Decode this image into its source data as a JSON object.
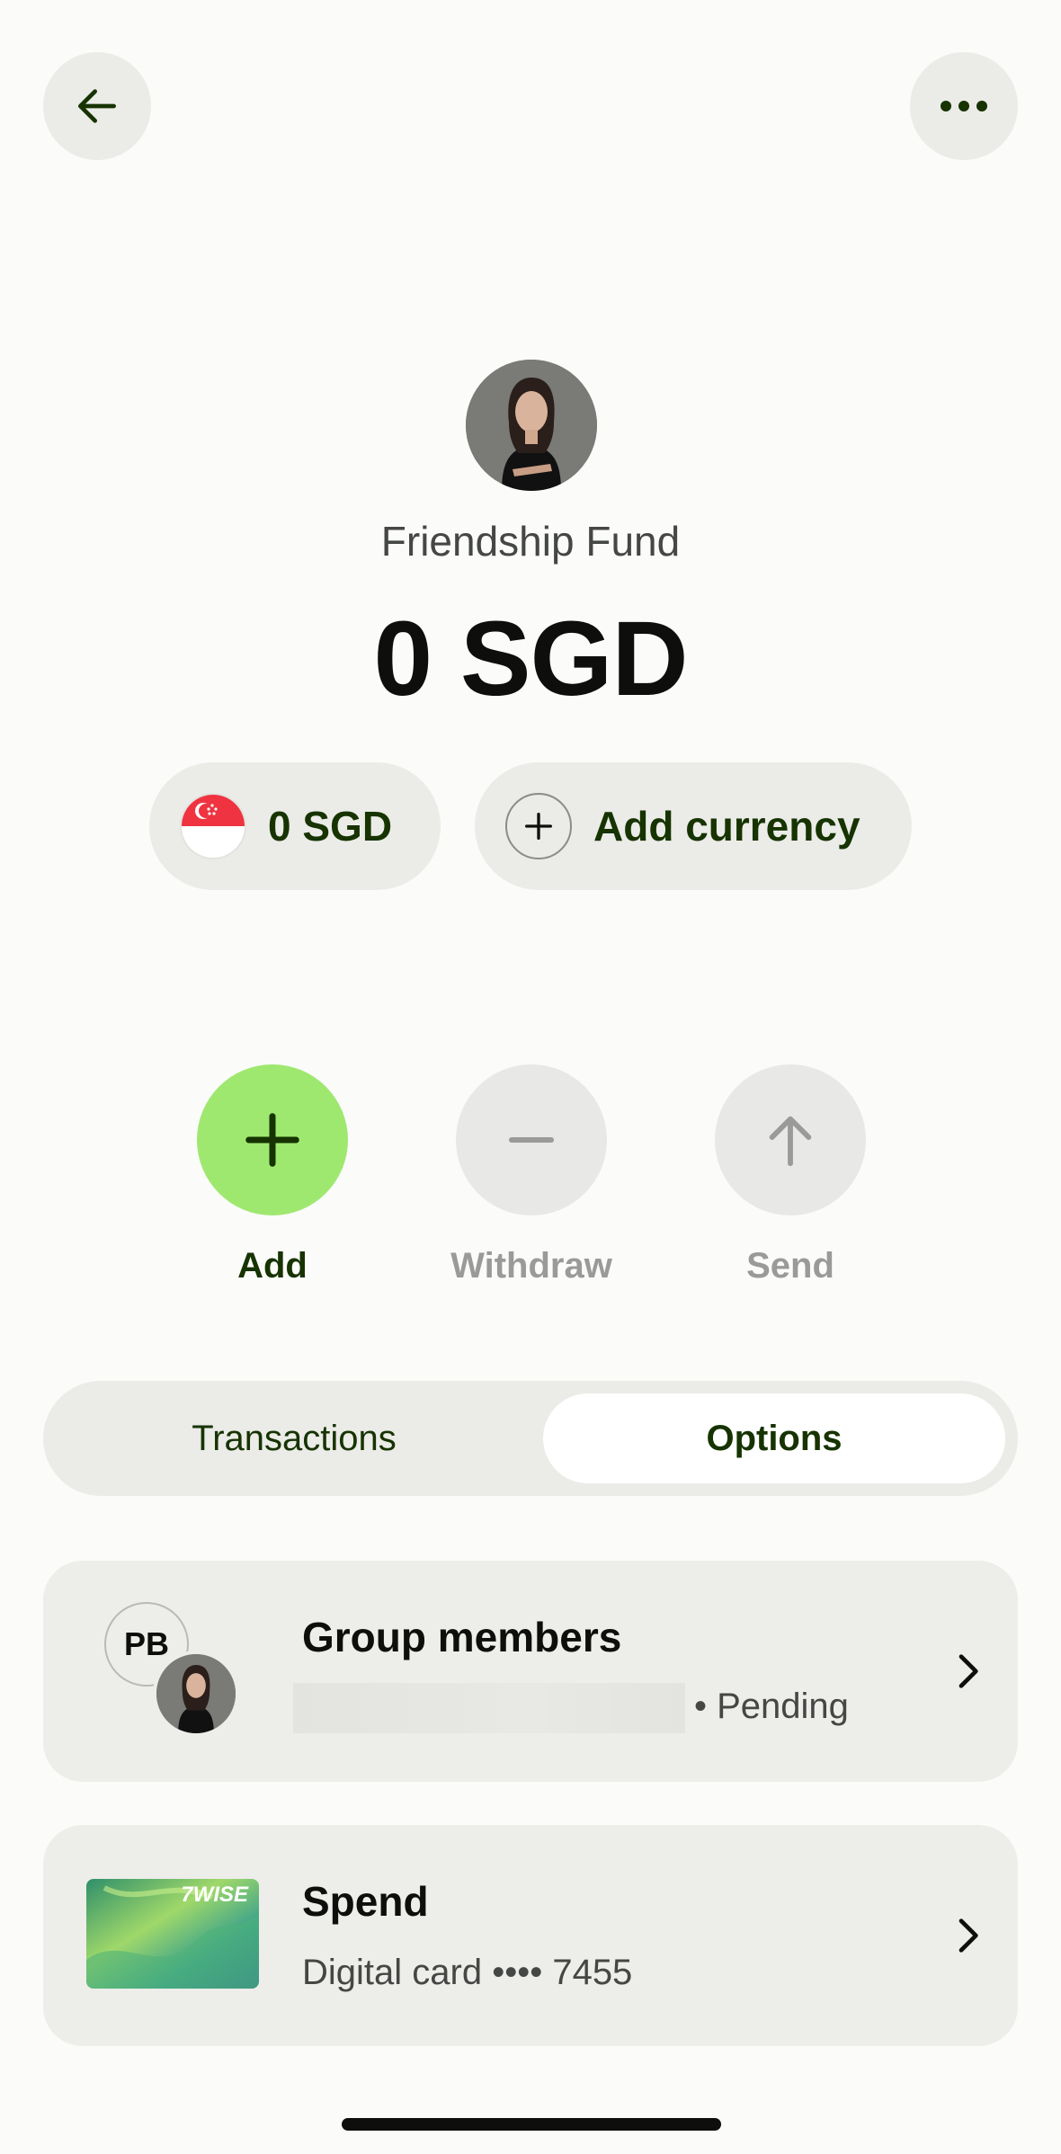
{
  "header": {
    "back_icon": "arrow-left-icon",
    "more_icon": "more-horizontal-icon"
  },
  "jar": {
    "title": "Friendship Fund",
    "balance": "0 SGD"
  },
  "currencies": {
    "sgd_label": "0 SGD",
    "sgd_flag": "singapore-flag-icon",
    "add_label": "Add currency"
  },
  "actions": [
    {
      "label": "Add",
      "icon": "plus-icon",
      "state": "enabled"
    },
    {
      "label": "Withdraw",
      "icon": "minus-icon",
      "state": "disabled"
    },
    {
      "label": "Send",
      "icon": "arrow-up-icon",
      "state": "disabled"
    }
  ],
  "tabs": [
    {
      "label": "Transactions",
      "selected": false
    },
    {
      "label": "Options",
      "selected": true
    }
  ],
  "members_card": {
    "title": "Group members",
    "initials": "PB",
    "status": "• Pending"
  },
  "spend_card": {
    "title": "Spend",
    "subtitle": "Digital card •••• 7455",
    "card_brand": "7WISE"
  },
  "colors": {
    "accent_green": "#9fe870",
    "dark_green": "#163300",
    "surface": "#ebebe8",
    "background": "#fbfbfa"
  }
}
